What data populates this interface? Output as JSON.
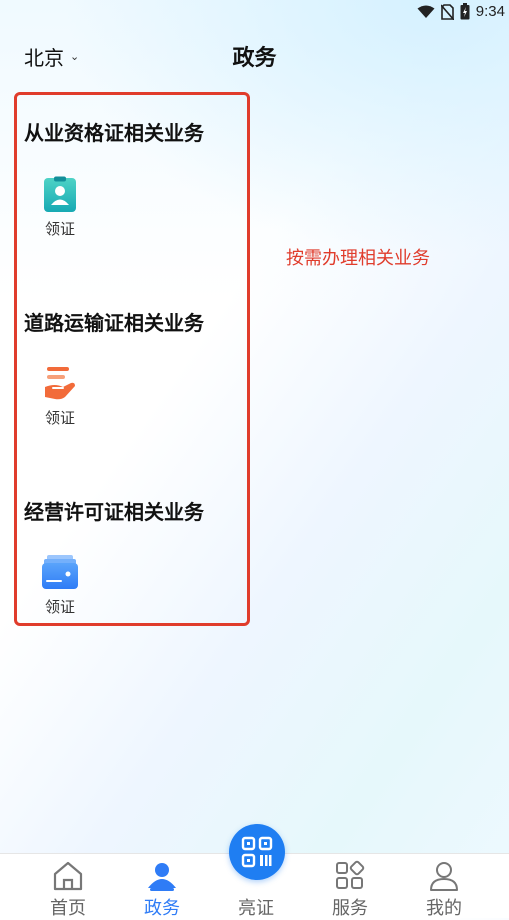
{
  "status_bar": {
    "time": "9:34",
    "icons": [
      "wifi-icon",
      "no-sim-icon",
      "battery-icon"
    ]
  },
  "header": {
    "city": "北京",
    "title": "政务"
  },
  "sections": [
    {
      "title": "从业资格证相关业务",
      "item": {
        "label": "领证",
        "icon": "id-card-icon"
      }
    },
    {
      "title": "道路运输证相关业务",
      "item": {
        "label": "领证",
        "icon": "hand-receive-icon"
      }
    },
    {
      "title": "经营许可证相关业务",
      "item": {
        "label": "领证",
        "icon": "wallet-card-icon"
      }
    }
  ],
  "annotation": "按需办理相关业务",
  "bottom_nav": {
    "items": [
      {
        "label": "首页",
        "icon": "home-icon",
        "active": false
      },
      {
        "label": "政务",
        "icon": "person-icon",
        "active": true
      },
      {
        "label": "亮证",
        "icon": "qr-code-icon",
        "active": false
      },
      {
        "label": "服务",
        "icon": "grid-icon",
        "active": false
      },
      {
        "label": "我的",
        "icon": "profile-icon",
        "active": false
      }
    ]
  },
  "colors": {
    "accent": "#2f7cf6",
    "annotation": "#e03c2c",
    "center_button": "#1f7ef2"
  }
}
